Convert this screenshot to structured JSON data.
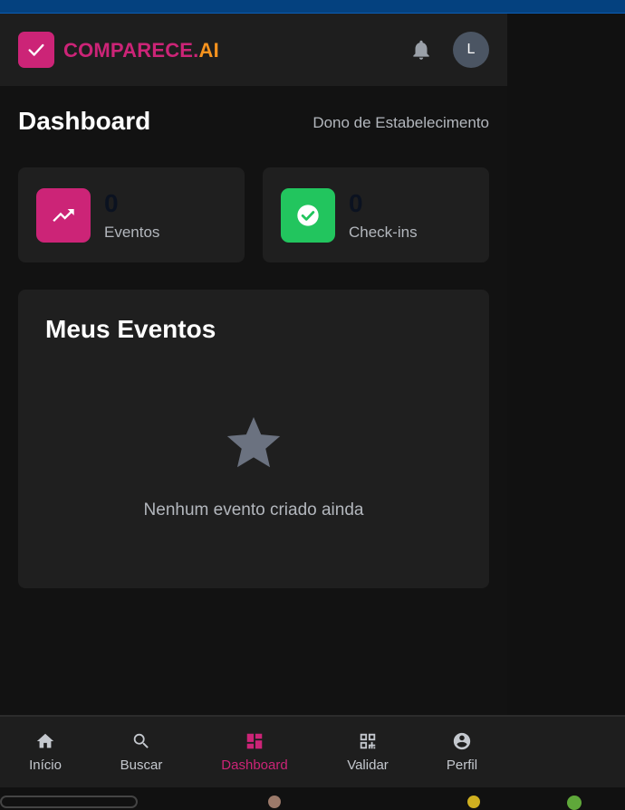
{
  "header": {
    "brand_part1": "COMPARECE.",
    "brand_part2": "AI",
    "avatar_initial": "L"
  },
  "page": {
    "title": "Dashboard",
    "role": "Dono de Estabelecimento"
  },
  "stats": [
    {
      "value": "0",
      "label": "Eventos",
      "icon": "trending-up-icon",
      "color": "#cc2477"
    },
    {
      "value": "0",
      "label": "Check-ins",
      "icon": "check-circle-icon",
      "color": "#22c55e"
    }
  ],
  "events": {
    "title": "Meus Eventos",
    "empty_text": "Nenhum evento criado ainda",
    "empty_icon": "star-icon"
  },
  "nav": {
    "items": [
      {
        "label": "Início",
        "icon": "home-icon"
      },
      {
        "label": "Buscar",
        "icon": "search-icon"
      },
      {
        "label": "Dashboard",
        "icon": "dashboard-icon",
        "active": true
      },
      {
        "label": "Validar",
        "icon": "qr-code-icon"
      },
      {
        "label": "Perfil",
        "icon": "account-circle-icon"
      }
    ]
  },
  "colors": {
    "accent": "#cc2477",
    "brand_orange": "#f7931e",
    "success": "#22c55e"
  }
}
